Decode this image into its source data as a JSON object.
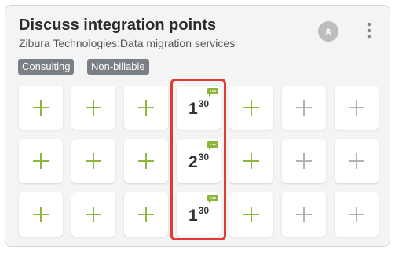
{
  "card": {
    "title": "Discuss integration points",
    "subtitle": "Zibura Technologies:Data migration services",
    "tags": [
      "Consulting",
      "Non-billable"
    ],
    "collapse_icon": "chevron-double-up-icon",
    "menu_icon": "kebab-menu-icon"
  },
  "grid": {
    "rows": [
      [
        {
          "type": "add",
          "state": "active"
        },
        {
          "type": "add",
          "state": "active"
        },
        {
          "type": "add",
          "state": "active"
        },
        {
          "type": "entry",
          "hours": "1",
          "minutes": "30",
          "has_comment": true
        },
        {
          "type": "add",
          "state": "active"
        },
        {
          "type": "add",
          "state": "disabled"
        },
        {
          "type": "add",
          "state": "disabled"
        }
      ],
      [
        {
          "type": "add",
          "state": "active"
        },
        {
          "type": "add",
          "state": "active"
        },
        {
          "type": "add",
          "state": "active"
        },
        {
          "type": "entry",
          "hours": "2",
          "minutes": "30",
          "has_comment": true
        },
        {
          "type": "add",
          "state": "active"
        },
        {
          "type": "add",
          "state": "disabled"
        },
        {
          "type": "add",
          "state": "disabled"
        }
      ],
      [
        {
          "type": "add",
          "state": "active"
        },
        {
          "type": "add",
          "state": "active"
        },
        {
          "type": "add",
          "state": "active"
        },
        {
          "type": "entry",
          "hours": "1",
          "minutes": "30",
          "has_comment": true
        },
        {
          "type": "add",
          "state": "active"
        },
        {
          "type": "add",
          "state": "disabled"
        },
        {
          "type": "add",
          "state": "disabled"
        }
      ]
    ]
  },
  "colors": {
    "plus_active": "#8cb63c",
    "plus_disabled": "#b3b3b3",
    "comment_badge": "#8cb63c",
    "highlight": "#e53935",
    "tag_bg": "#7a7f85"
  }
}
